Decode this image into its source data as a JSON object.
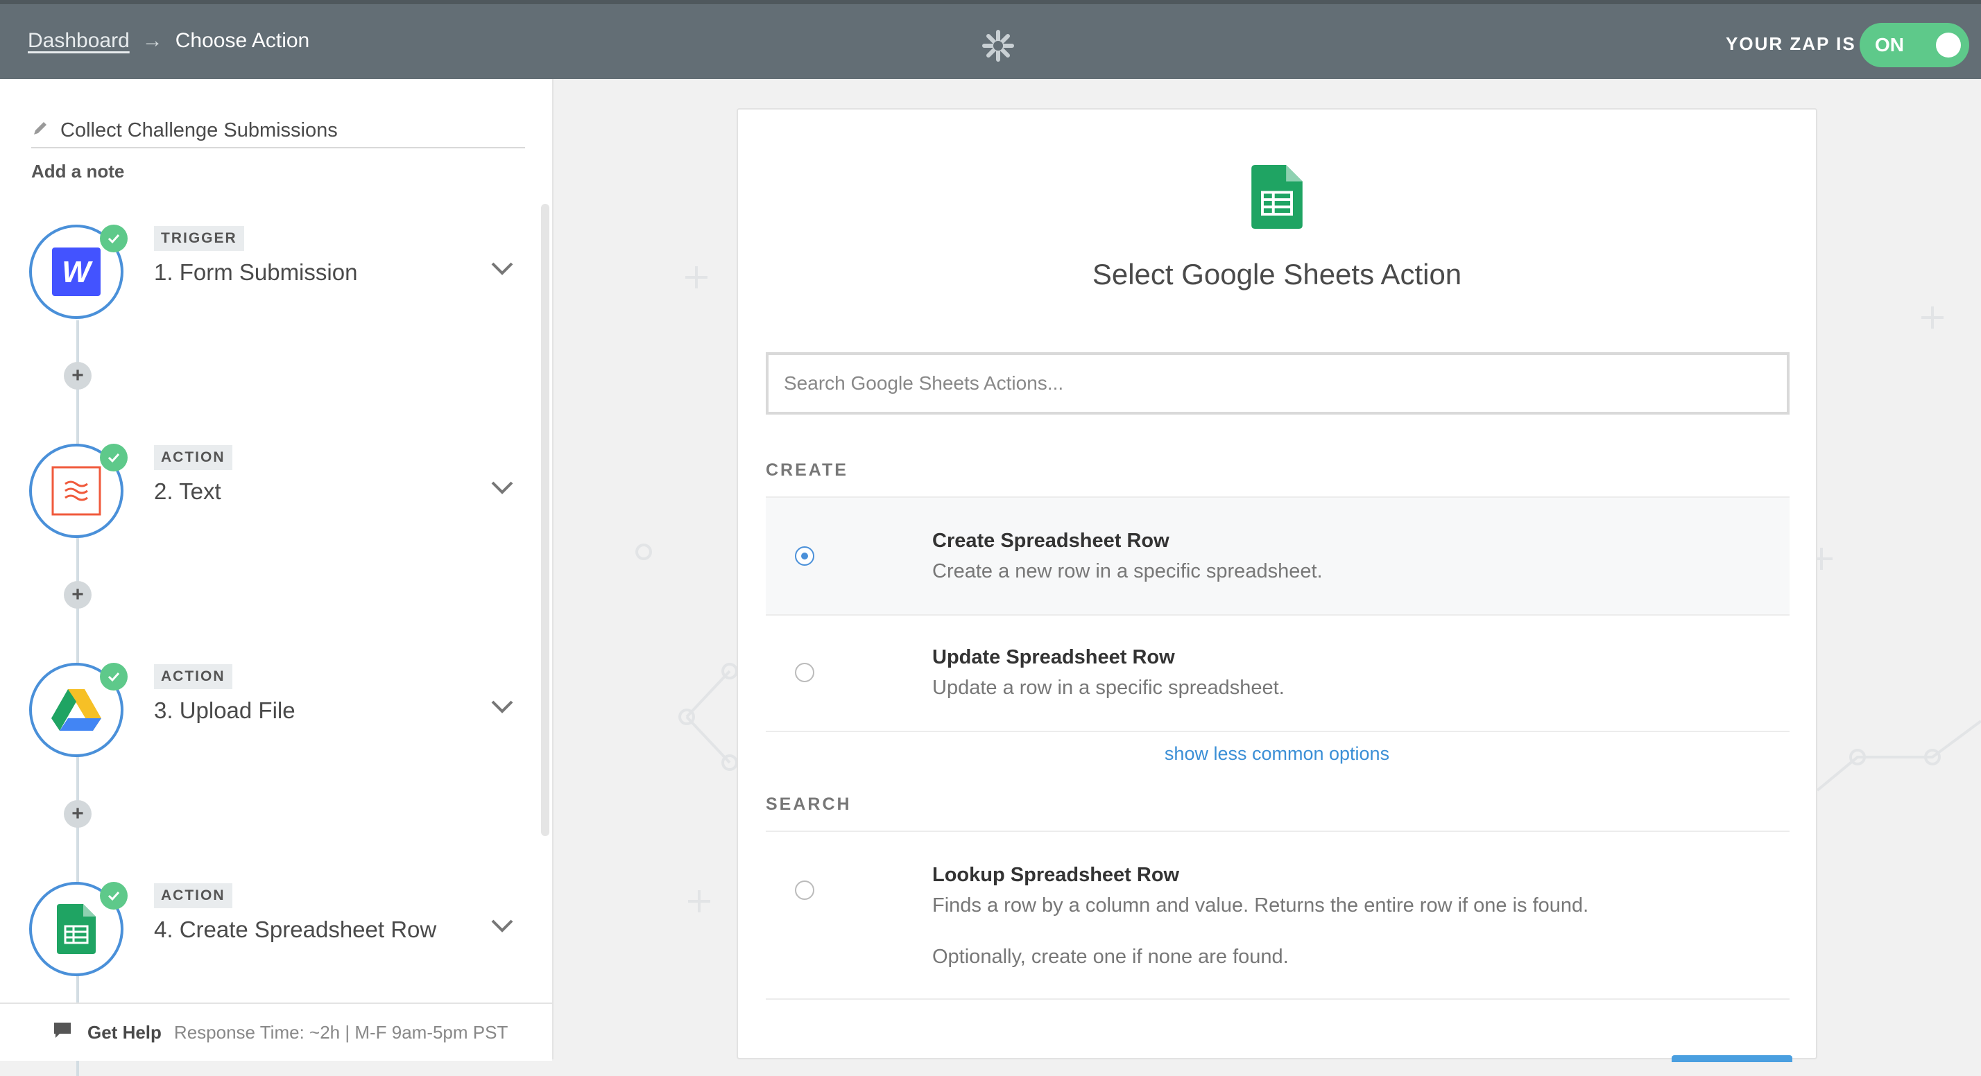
{
  "header": {
    "breadcrumb_dashboard": "Dashboard",
    "breadcrumb_arrow": "→",
    "breadcrumb_current": "Choose Action",
    "zap_status_label": "YOUR ZAP IS",
    "toggle_label": "ON",
    "logo_icon": "zapier-asterisk-icon"
  },
  "sidebar": {
    "zap_name": "Collect Challenge Submissions",
    "add_note": "Add a note",
    "steps": [
      {
        "tag": "TRIGGER",
        "title": "1. Form Submission",
        "icon": "webflow-icon"
      },
      {
        "tag": "ACTION",
        "title": "2. Text",
        "icon": "formatter-icon"
      },
      {
        "tag": "ACTION",
        "title": "3. Upload File",
        "icon": "google-drive-icon"
      },
      {
        "tag": "ACTION",
        "title": "4. Create Spreadsheet Row",
        "icon": "google-sheets-icon"
      }
    ],
    "add_step_symbol": "+",
    "help_label": "Get Help",
    "help_response": "Response Time: ~2h | M-F 9am-5pm PST"
  },
  "main": {
    "heading": "Select Google Sheets Action",
    "search_placeholder": "Search Google Sheets Actions...",
    "create_section": "CREATE",
    "search_section": "SEARCH",
    "show_less": "show less common options",
    "options": [
      {
        "title": "Create Spreadsheet Row",
        "desc": "Create a new row in a specific spreadsheet.",
        "selected": true
      },
      {
        "title": "Update Spreadsheet Row",
        "desc": "Update a row in a specific spreadsheet.",
        "selected": false
      },
      {
        "title": "Lookup Spreadsheet Row",
        "desc": "Finds a row by a column and value. Returns the entire row if one is found.",
        "desc2": "Optionally, create one if none are found.",
        "selected": false
      }
    ]
  },
  "colors": {
    "topbar": "#636e75",
    "toggle_on": "#5ec98a",
    "accent_blue": "#4a90d9",
    "check_green": "#5ec98a"
  }
}
